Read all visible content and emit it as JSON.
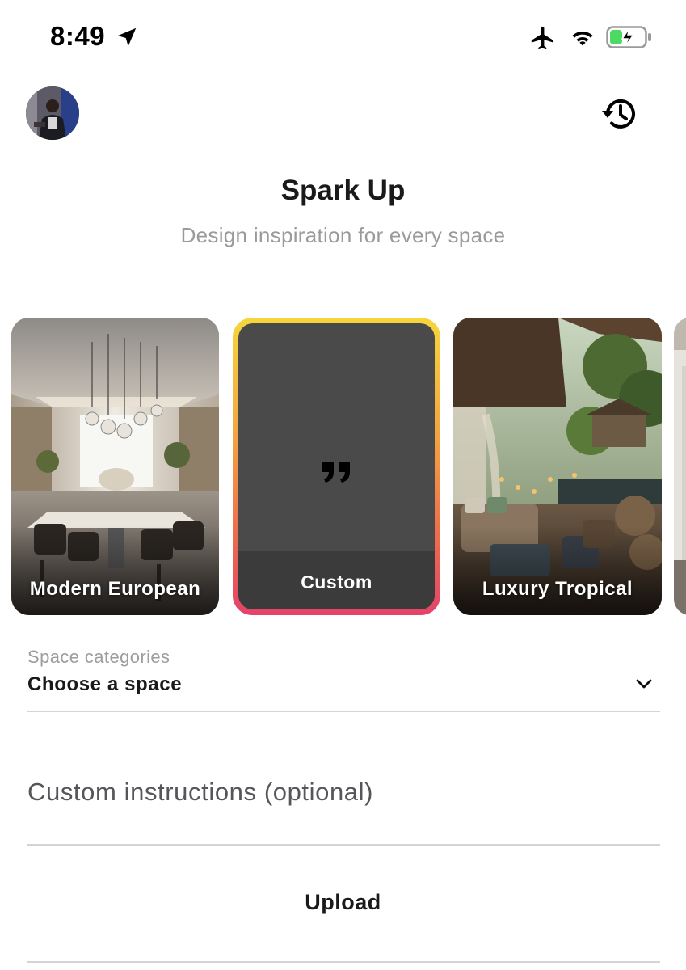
{
  "status_bar": {
    "time": "8:49",
    "icons": [
      "location-arrow-icon",
      "airplane-icon",
      "wifi-icon",
      "battery-charging-icon"
    ],
    "battery_color": "#4cd964"
  },
  "header": {
    "avatar": "user-avatar",
    "history_icon": "history-icon",
    "title": "Spark Up",
    "subtitle": "Design inspiration for every space"
  },
  "styles": [
    {
      "label": "Modern European"
    },
    {
      "label": "Custom",
      "icon": "quote-icon",
      "selected": true
    },
    {
      "label": "Luxury Tropical"
    }
  ],
  "space_category": {
    "caption": "Space categories",
    "value": "Choose a space",
    "icon": "chevron-down-icon"
  },
  "custom_instructions": {
    "placeholder": "Custom instructions (optional)"
  },
  "upload": {
    "label": "Upload"
  },
  "colors": {
    "accent_gradient": [
      "#f6d63c",
      "#f3a33f",
      "#ec6a4e",
      "#e4436a"
    ],
    "custom_card_bg": "#4a4a4a",
    "subtitle": "#9a9a9a"
  }
}
